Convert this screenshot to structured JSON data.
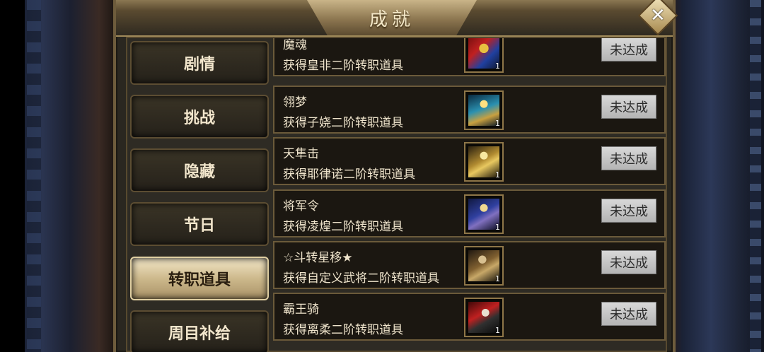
{
  "title": "成就",
  "close_label": "✕",
  "tabs": [
    "剧情",
    "挑战",
    "隐藏",
    "节日",
    "转职道具",
    "周目补给"
  ],
  "active_tab": 4,
  "achievements": [
    {
      "name": "魔魂",
      "desc": "获得皇非二阶转职道具",
      "qty": "1",
      "status": "未达成",
      "icon": "warrior-red-blue-icon"
    },
    {
      "name": "翎梦",
      "desc": "获得子娆二阶转职道具",
      "qty": "1",
      "status": "未达成",
      "icon": "warrior-cyan-icon"
    },
    {
      "name": "天隼击",
      "desc": "获得耶律诺二阶转职道具",
      "qty": "1",
      "status": "未达成",
      "icon": "warrior-gold-icon"
    },
    {
      "name": "将军令",
      "desc": "获得凌煌二阶转职道具",
      "qty": "1",
      "status": "未达成",
      "icon": "warrior-blue-icon"
    },
    {
      "name": "☆斗转星移★",
      "desc": "获得自定义武将二阶转职道具",
      "qty": "1",
      "status": "未达成",
      "icon": "warrior-tan-icon"
    },
    {
      "name": "霸王骑",
      "desc": "获得离柔二阶转职道具",
      "qty": "1",
      "status": "未达成",
      "icon": "warrior-red-icon"
    }
  ],
  "colors": {
    "accent": "#cdb98c",
    "status_bg": "#c4c4c4"
  }
}
